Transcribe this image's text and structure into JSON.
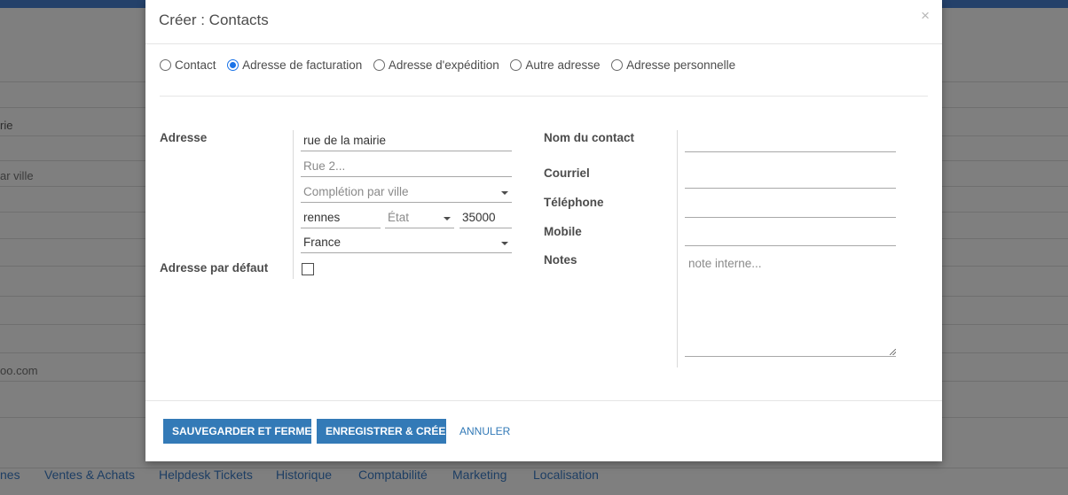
{
  "background": {
    "fragments": [
      "rie",
      "ar ville",
      "oo.com"
    ],
    "tabs": [
      "nes",
      "Ventes & Achats",
      "Helpdesk Tickets",
      "Historique",
      "Comptabilité",
      "Marketing",
      "Localisation"
    ]
  },
  "dialog": {
    "title": "Créer : Contacts",
    "close": "×",
    "address_types": [
      {
        "label": "Contact",
        "checked": false
      },
      {
        "label": "Adresse de facturation",
        "checked": true
      },
      {
        "label": "Adresse d'expédition",
        "checked": false
      },
      {
        "label": "Autre adresse",
        "checked": false
      },
      {
        "label": "Adresse personnelle",
        "checked": false
      }
    ],
    "labels": {
      "address": "Adresse",
      "default_address": "Adresse par défaut",
      "contact_name": "Nom du contact",
      "email": "Courriel",
      "phone": "Téléphone",
      "mobile": "Mobile",
      "notes": "Notes"
    },
    "fields": {
      "street": {
        "value": "rue de la mairie"
      },
      "street2": {
        "placeholder": "Rue 2..."
      },
      "city_completion": {
        "placeholder": "Complétion par ville"
      },
      "city": {
        "value": "rennes"
      },
      "state": {
        "placeholder": "État"
      },
      "zip": {
        "value": "35000"
      },
      "country": {
        "value": "France"
      },
      "default_address_checked": false,
      "contact_name": {
        "value": ""
      },
      "email": {
        "value": ""
      },
      "phone": {
        "value": ""
      },
      "mobile": {
        "value": ""
      },
      "notes": {
        "placeholder": "note interne..."
      }
    },
    "buttons": {
      "save_close": "SAUVEGARDER ET FERMER",
      "save_new": "ENREGISTRER & CRÉER",
      "cancel": "ANNULER"
    }
  }
}
